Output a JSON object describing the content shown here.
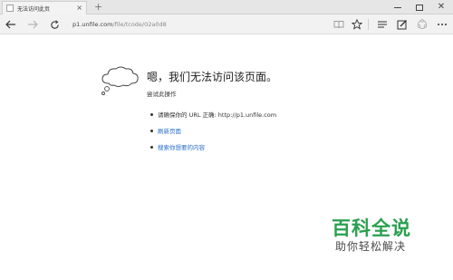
{
  "tab": {
    "title": "无法访问此页",
    "close_glyph": "×",
    "new_tab_glyph": "+"
  },
  "window": {
    "close_glyph": "✕"
  },
  "address": {
    "host": "p1.unfile.com",
    "path": "/file/tcode/02a0d8"
  },
  "error": {
    "title": "嗯，我们无法访问该页面。",
    "subtitle": "尝试此操作",
    "items": [
      {
        "text": "请确保你的 URL 正确: http://p1.unfile.com",
        "type": "text"
      },
      {
        "text": "刷新页面",
        "type": "link"
      },
      {
        "text": "搜索你想要的内容",
        "type": "link"
      }
    ]
  },
  "watermark": {
    "main": "百科全说",
    "sub": "助你轻松解决"
  },
  "colors": {
    "link": "#2a6fc9",
    "watermark_green": "#2aa04e",
    "chrome_bg": "#f2f2f2"
  },
  "icons": {
    "back": "arrow-left-icon",
    "forward": "arrow-right-icon",
    "refresh": "refresh-icon",
    "reading_view": "book-icon",
    "favorite": "star-icon",
    "hub": "hub-lines-icon",
    "web_note": "pen-note-icon",
    "share": "share-icon",
    "more": "more-dots-icon",
    "cloud": "cloud-thought-icon"
  }
}
